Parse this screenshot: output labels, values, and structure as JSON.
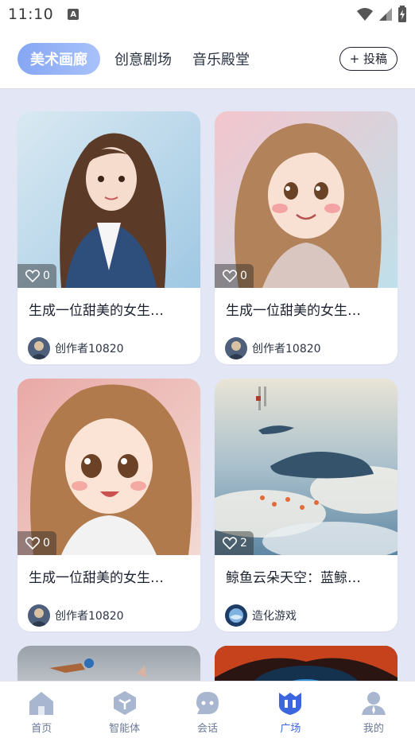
{
  "status_bar": {
    "time": "11:10",
    "notification_icon": "A"
  },
  "tabs": [
    {
      "label": "美术画廊",
      "active": true
    },
    {
      "label": "创意剧场",
      "active": false
    },
    {
      "label": "音乐殿堂",
      "active": false
    }
  ],
  "submit_button": "+ 投稿",
  "cards": [
    {
      "likes": "0",
      "title": "生成一位甜美的女生…",
      "author": "创作者10820"
    },
    {
      "likes": "0",
      "title": "生成一位甜美的女生…",
      "author": "创作者10820"
    },
    {
      "likes": "0",
      "title": "生成一位甜美的女生…",
      "author": "创作者10820"
    },
    {
      "likes": "2",
      "title": "鲸鱼云朵天空：蓝鲸…",
      "author": "造化游戏"
    }
  ],
  "bottom_nav": [
    {
      "label": "首页",
      "icon": "home-icon"
    },
    {
      "label": "智能体",
      "icon": "agent-icon"
    },
    {
      "label": "会话",
      "icon": "chat-icon"
    },
    {
      "label": "广场",
      "icon": "plaza-icon",
      "active": true
    },
    {
      "label": "我的",
      "icon": "profile-icon"
    }
  ],
  "colors": {
    "accent": "#3b66e0",
    "tab_gradient_start": "#86a6f4",
    "background": "#e3e7f5"
  }
}
